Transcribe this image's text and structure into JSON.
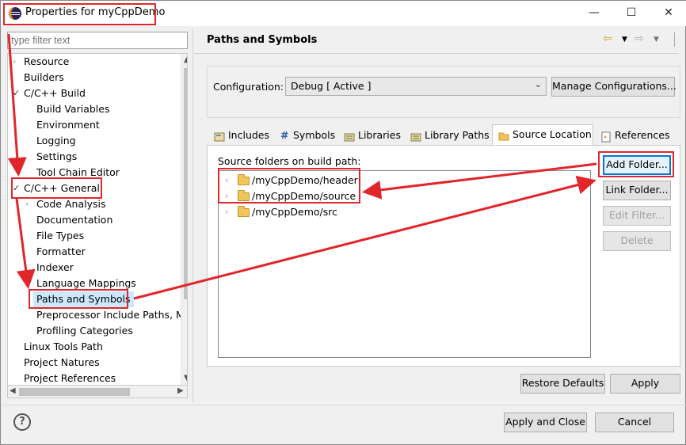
{
  "window": {
    "title": "Properties for myCppDemo",
    "minimize": "—",
    "maximize": "☐",
    "close": "✕"
  },
  "filter": {
    "placeholder": "type filter text"
  },
  "tree": {
    "items": [
      {
        "label": "Resource"
      },
      {
        "label": "Builders"
      },
      {
        "label": "C/C++ Build"
      },
      {
        "label": "Build Variables"
      },
      {
        "label": "Environment"
      },
      {
        "label": "Logging"
      },
      {
        "label": "Settings"
      },
      {
        "label": "Tool Chain Editor"
      },
      {
        "label": "C/C++ General"
      },
      {
        "label": "Code Analysis"
      },
      {
        "label": "Documentation"
      },
      {
        "label": "File Types"
      },
      {
        "label": "Formatter"
      },
      {
        "label": "Indexer"
      },
      {
        "label": "Language Mappings"
      },
      {
        "label": "Paths and Symbols"
      },
      {
        "label": "Preprocessor Include Paths, M"
      },
      {
        "label": "Profiling Categories"
      },
      {
        "label": "Linux Tools Path"
      },
      {
        "label": "Project Natures"
      },
      {
        "label": "Project References"
      }
    ]
  },
  "page": {
    "title": "Paths and Symbols",
    "configuration_label": "Configuration:",
    "configuration_value": "Debug  [ Active ]",
    "manage_button": "Manage Configurations..."
  },
  "tabs": [
    {
      "label": "Includes",
      "icon": "includes-icon"
    },
    {
      "label": "Symbols",
      "icon": "hash-icon"
    },
    {
      "label": "Libraries",
      "icon": "libraries-icon"
    },
    {
      "label": "Library Paths",
      "icon": "library-paths-icon"
    },
    {
      "label": "Source Location",
      "icon": "source-folder-icon"
    },
    {
      "label": "References",
      "icon": "references-icon"
    }
  ],
  "source_panel": {
    "label": "Source folders on build path:",
    "folders": [
      "/myCppDemo/header",
      "/myCppDemo/source",
      "/myCppDemo/src"
    ],
    "buttons": {
      "add_folder": "Add Folder...",
      "link_folder": "Link Folder...",
      "edit_filter": "Edit Filter...",
      "delete": "Delete"
    }
  },
  "footer": {
    "restore_defaults": "Restore Defaults",
    "apply": "Apply",
    "apply_and_close": "Apply and Close",
    "cancel": "Cancel",
    "help": "?"
  },
  "colors": {
    "annotation": "#e0262b",
    "accent": "#0078d7",
    "selection": "#cce8ff"
  }
}
